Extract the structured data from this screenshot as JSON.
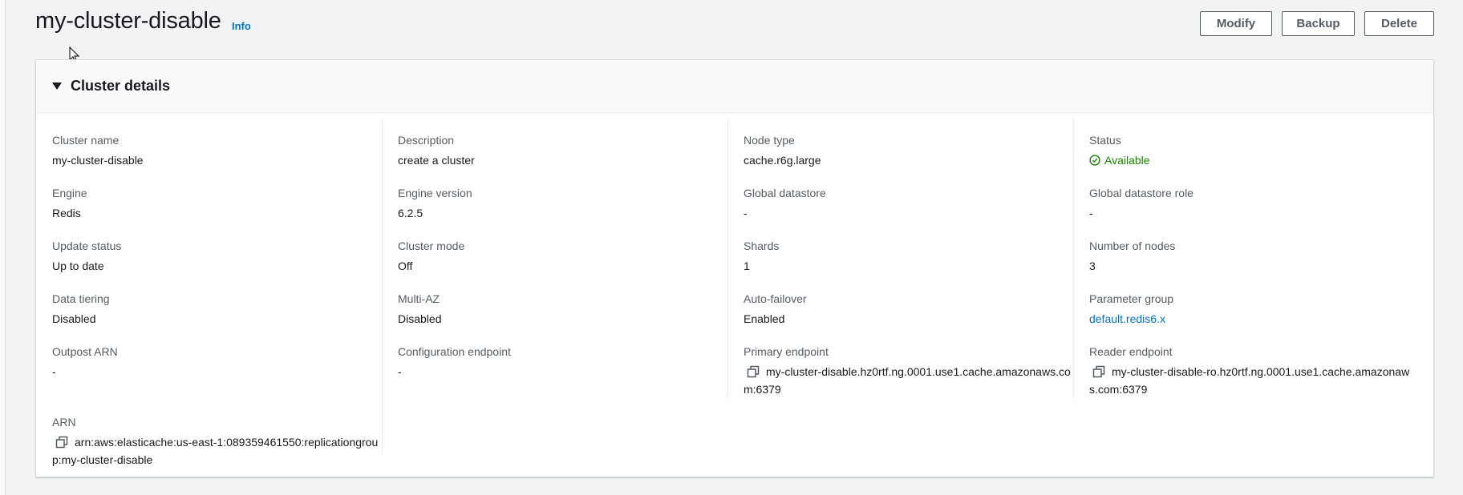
{
  "header": {
    "title": "my-cluster-disable",
    "info": "Info",
    "buttons": {
      "modify": "Modify",
      "backup": "Backup",
      "delete": "Delete"
    }
  },
  "panel": {
    "title": "Cluster details",
    "columns": [
      [
        {
          "label": "Cluster name",
          "value": "my-cluster-disable"
        },
        {
          "label": "Engine",
          "value": "Redis"
        },
        {
          "label": "Update status",
          "value": "Up to date"
        },
        {
          "label": "Data tiering",
          "value": "Disabled"
        },
        {
          "label": "Outpost ARN",
          "value": "-"
        },
        {
          "label": "ARN",
          "value": "arn:aws:elasticache:us-east-1:089359461550:replicationgroup:my-cluster-disable"
        }
      ],
      [
        {
          "label": "Description",
          "value": "create a cluster"
        },
        {
          "label": "Engine version",
          "value": "6.2.5"
        },
        {
          "label": "Cluster mode",
          "value": "Off"
        },
        {
          "label": "Multi-AZ",
          "value": "Disabled"
        },
        {
          "label": "Configuration endpoint",
          "value": "-"
        }
      ],
      [
        {
          "label": "Node type",
          "value": "cache.r6g.large"
        },
        {
          "label": "Global datastore",
          "value": "-"
        },
        {
          "label": "Shards",
          "value": "1"
        },
        {
          "label": "Auto-failover",
          "value": "Enabled"
        },
        {
          "label": "Primary endpoint",
          "value": "my-cluster-disable.hz0rtf.ng.0001.use1.cache.amazonaws.com:6379"
        }
      ],
      [
        {
          "label": "Status",
          "value": "Available"
        },
        {
          "label": "Global datastore role",
          "value": "-"
        },
        {
          "label": "Number of nodes",
          "value": "3"
        },
        {
          "label": "Parameter group",
          "value": "default.redis6.x"
        },
        {
          "label": "Reader endpoint",
          "value": "my-cluster-disable-ro.hz0rtf.ng.0001.use1.cache.amazonaws.com:6379"
        }
      ]
    ]
  },
  "colors": {
    "link": "#0073bb",
    "status_available": "#1d8102",
    "background": "#f2f3f3"
  },
  "icons": {
    "status": "check-circle-icon",
    "copy": "copy-icon",
    "expand": "caret-down-icon"
  }
}
